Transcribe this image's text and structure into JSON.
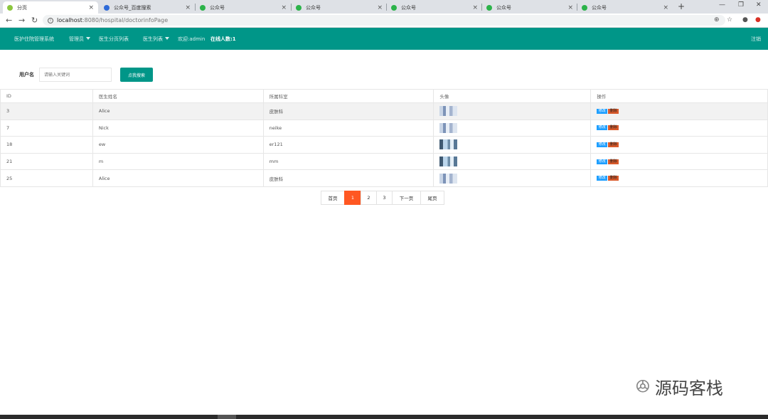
{
  "browser": {
    "tabs": [
      {
        "label": "分页",
        "icon_color": "#8cc63f"
      },
      {
        "label": "公众号_百度搜索",
        "icon_color": "#2f6bd8"
      },
      {
        "label": "公众号",
        "icon_color": "#2cb34a"
      },
      {
        "label": "公众号",
        "icon_color": "#2cb34a"
      },
      {
        "label": "公众号",
        "icon_color": "#2cb34a"
      },
      {
        "label": "公众号",
        "icon_color": "#2cb34a"
      },
      {
        "label": "公众号",
        "icon_color": "#2cb34a"
      }
    ],
    "close_glyph": "×",
    "new_tab_glyph": "+",
    "url_host": "localhost",
    "url_path": ":8080/hospital/doctorinfoPage"
  },
  "app": {
    "brand": "医护住院管理系统",
    "menu_admin": "管理员",
    "menu_doctor_page": "医生分页列表",
    "menu_doctor_list": "医生列表",
    "welcome": "欢迎:admin",
    "online": "在线人数:1",
    "logout": "注销",
    "accent_color": "#009688"
  },
  "search": {
    "label": "用户名",
    "placeholder": "请输入关键词",
    "button": "点我搜索"
  },
  "table": {
    "headers": {
      "id": "ID",
      "name": "医生姓名",
      "dept": "所属科室",
      "avatar": "头像",
      "ops": "操作"
    },
    "rows": [
      {
        "id": "3",
        "name": "Alice",
        "dept": "皮肤科",
        "avatar_style": "light",
        "edit": "修改",
        "del": "删除"
      },
      {
        "id": "7",
        "name": "Nick",
        "dept": "neike",
        "avatar_style": "light",
        "edit": "修改",
        "del": "删除"
      },
      {
        "id": "18",
        "name": "ew",
        "dept": "er121",
        "avatar_style": "dark",
        "edit": "修改",
        "del": "删除"
      },
      {
        "id": "21",
        "name": "m",
        "dept": "mm",
        "avatar_style": "dark",
        "edit": "修改",
        "del": "删除"
      },
      {
        "id": "25",
        "name": "Alice",
        "dept": "皮肤科",
        "avatar_style": "light",
        "edit": "修改",
        "del": "删除"
      }
    ]
  },
  "pagination": {
    "first": "首页",
    "pages": [
      "1",
      "2",
      "3"
    ],
    "current": "1",
    "next": "下一页",
    "last": "尾页"
  },
  "watermark": {
    "text": "源码客栈"
  }
}
